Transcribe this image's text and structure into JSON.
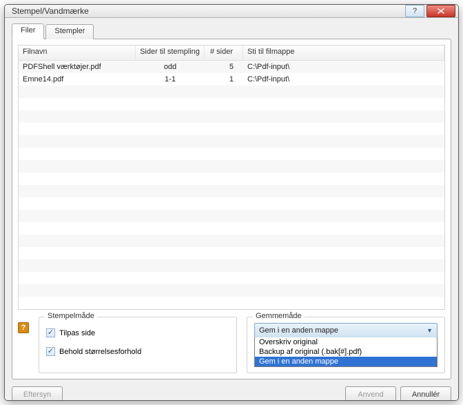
{
  "window": {
    "title": "Stempel/Vandmærke"
  },
  "tabs": [
    {
      "label": "Filer",
      "active": true
    },
    {
      "label": "Stempler",
      "active": false
    }
  ],
  "table": {
    "headers": {
      "filnavn": "Filnavn",
      "stempling": "Sider til stempling",
      "sider": "# sider",
      "sti": "Sti til filmappe"
    },
    "rows": [
      {
        "filnavn": "PDFShell værktøjer.pdf",
        "stempling": "odd",
        "sider": "5",
        "sti": "C:\\Pdf-input\\"
      },
      {
        "filnavn": "Emne14.pdf",
        "stempling": "1-1",
        "sider": "1",
        "sti": "C:\\Pdf-input\\"
      }
    ]
  },
  "stamp_mode": {
    "title": "Stempelmåde",
    "fit_page": {
      "label": "Tilpas side",
      "checked": true
    },
    "keep_ratio": {
      "label": "Behold størrelsesforhold",
      "checked": true
    }
  },
  "save_mode": {
    "title": "Gemmemåde",
    "selected": "Gem i en anden mappe",
    "options": [
      "Overskriv original",
      "Backup af original (.bak[#].pdf)",
      "Gem i en anden mappe"
    ]
  },
  "buttons": {
    "preview": "Eftersyn",
    "apply": "Anvend",
    "cancel": "Annullér"
  },
  "help_icon": "?"
}
